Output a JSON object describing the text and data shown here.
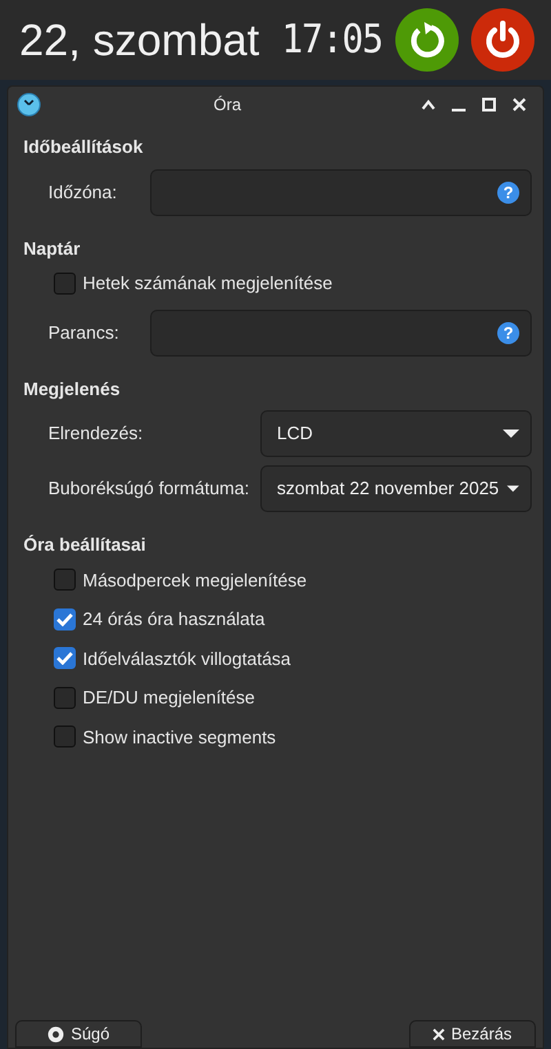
{
  "panel": {
    "date": "22, szombat",
    "time": "17:05"
  },
  "window": {
    "title": "Óra"
  },
  "sections": [
    {
      "title": "Időbeállítások",
      "rows": [
        {
          "kind": "field",
          "label": "Időzóna:",
          "help": "?"
        }
      ]
    },
    {
      "title": "Naptár",
      "rows": [
        {
          "kind": "checkbox",
          "label": "Hetek számának megjelenítése",
          "checked": false
        },
        {
          "kind": "field",
          "label": "Parancs:",
          "help": "?"
        }
      ]
    },
    {
      "title": "Megjelenés",
      "rows": [
        {
          "kind": "select",
          "label": "Elrendezés:",
          "value": "LCD"
        },
        {
          "kind": "select",
          "label": "Buboréksúgó formátuma:",
          "value": "szombat 22 november 2025"
        }
      ]
    },
    {
      "title": "Óra beállítasai",
      "rows": [
        {
          "kind": "checkbox",
          "label": "Másodpercek megjelenítése",
          "checked": false
        },
        {
          "kind": "checkbox",
          "label": "24 órás óra használata",
          "checked": true
        },
        {
          "kind": "checkbox",
          "label": "Időelválasztók villogtatása",
          "checked": true
        },
        {
          "kind": "checkbox",
          "label": "DE/DU megjelenítése",
          "checked": false
        },
        {
          "kind": "checkbox",
          "label": "Show inactive segments",
          "checked": false
        }
      ]
    }
  ],
  "buttons": [
    {
      "label": "Súgó",
      "kind": "help"
    },
    {
      "label": "Bezárás",
      "kind": "close"
    }
  ]
}
